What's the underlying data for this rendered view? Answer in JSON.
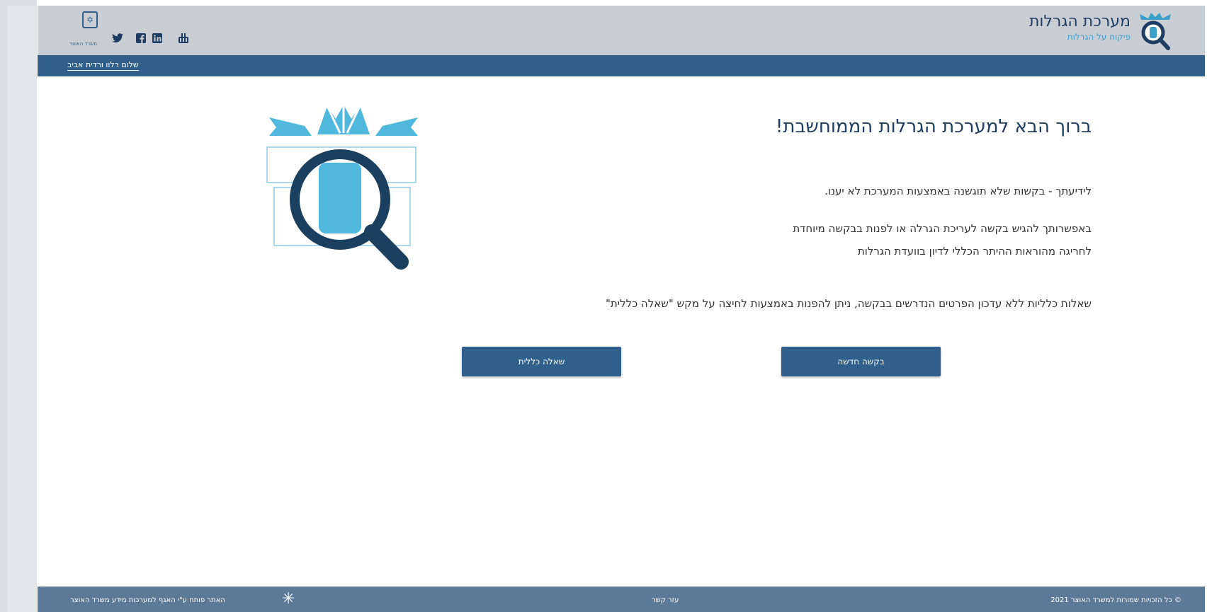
{
  "header": {
    "brand_title": "מערכת הגרלות",
    "brand_subtitle": "פיקוח על הגרלות",
    "gov_caption": "משרד האוצר",
    "social_icons": [
      "youtube-icon",
      "linkedin-icon",
      "facebook-icon",
      "twitter-icon"
    ]
  },
  "nav": {
    "greeting": "שלום רלוו ורדית אביב"
  },
  "main": {
    "welcome_title": "ברוך הבא למערכת הגרלות הממוחשבת!",
    "para_1": "לידיעתך - בקשות שלא תוגשנה באמצעות המערכת לא יענו.",
    "para_2_line_1": "באפשרותך להגיש בקשה לעריכת הגרלה או לפנות בבקשה מיוחדת",
    "para_2_line_2": "לחריגה מהוראות ההיתר הכללי לדיון בוועדת הגרלות",
    "para_3": "שאלות כלליות ללא עדכון הפרטים הנדרשים בבקשה, ניתן להפנות באמצעות לחיצה על מקש \"שאלה כללית\"",
    "new_request_button": "בקשה חדשה",
    "general_question_button": "שאלה כללית"
  },
  "footer": {
    "copyright": "© כל הזכויות שמורות למשרד האוצר 2021",
    "help": "עזר קשר",
    "credit": "האתר פותח ע\"י האגף למערכות מידע משרד האוצר"
  },
  "colors": {
    "primary": "#2f5f8a",
    "accent": "#3a9fc9",
    "header_bg": "#c9ced4",
    "footer_bg": "#5b7a98"
  }
}
